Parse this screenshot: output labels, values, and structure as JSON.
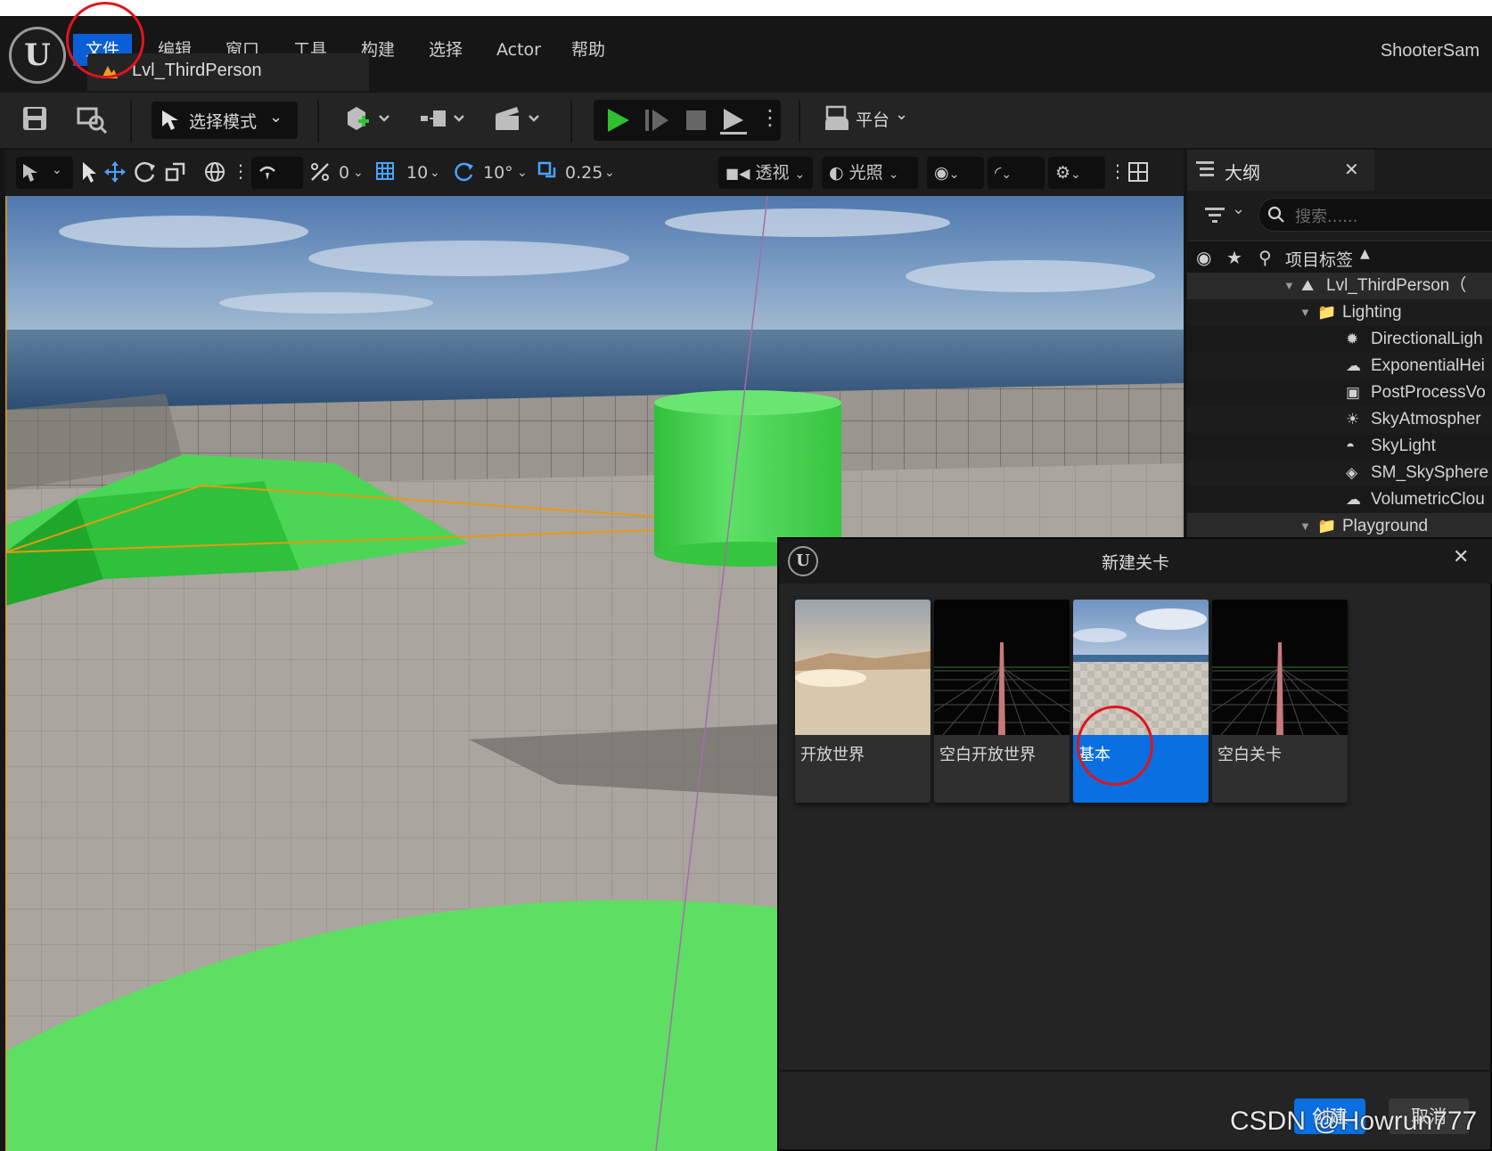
{
  "menubar": {
    "items": [
      "文件",
      "编辑",
      "窗口",
      "工具",
      "构建",
      "选择",
      "Actor",
      "帮助"
    ],
    "active_item": "文件",
    "project_name": "ShooterSam"
  },
  "level_tab": {
    "label": "Lvl_ThirdPerson"
  },
  "toolbar": {
    "select_mode_label": "选择模式",
    "platform_label": "平台"
  },
  "viewport_toolbar": {
    "rotation_snap": "0",
    "grid_snap": "10",
    "angle_snap": "10°",
    "scale_snap": "0.25",
    "perspective_label": "透视",
    "lighting_label": "光照"
  },
  "outliner": {
    "tab_title": "大纲",
    "search_placeholder": "搜索......",
    "column_label": "项目标签",
    "rows": [
      {
        "label": "Lvl_ThirdPerson（",
        "depth": 0,
        "icon": "level-icon"
      },
      {
        "label": "Lighting",
        "depth": 1,
        "icon": "folder-icon"
      },
      {
        "label": "DirectionalLigh",
        "depth": 2,
        "icon": "directional-light-icon"
      },
      {
        "label": "ExponentialHei",
        "depth": 2,
        "icon": "fog-icon"
      },
      {
        "label": "PostProcessVo",
        "depth": 2,
        "icon": "post-process-icon"
      },
      {
        "label": "SkyAtmospher",
        "depth": 2,
        "icon": "sky-atmosphere-icon"
      },
      {
        "label": "SkyLight",
        "depth": 2,
        "icon": "sky-light-icon"
      },
      {
        "label": "SM_SkySphere",
        "depth": 2,
        "icon": "mesh-icon"
      },
      {
        "label": "VolumetricClou",
        "depth": 2,
        "icon": "cloud-icon"
      },
      {
        "label": "Playground",
        "depth": 1,
        "icon": "folder-icon"
      }
    ]
  },
  "dialog": {
    "title": "新建关卡",
    "templates": [
      {
        "label": "开放世界",
        "selected": false
      },
      {
        "label": "空白开放世界",
        "selected": false
      },
      {
        "label": "基本",
        "selected": true
      },
      {
        "label": "空白关卡",
        "selected": false
      }
    ],
    "create_label": "创建",
    "cancel_label": "取消"
  },
  "watermark": "CSDN @Howrun777",
  "colors": {
    "accent": "#0b5fd6",
    "selected_card": "#0a6fe0",
    "play_green": "#2fbf2f",
    "annotation_red": "#e0141e",
    "mesh_green": "#3fd14a"
  }
}
